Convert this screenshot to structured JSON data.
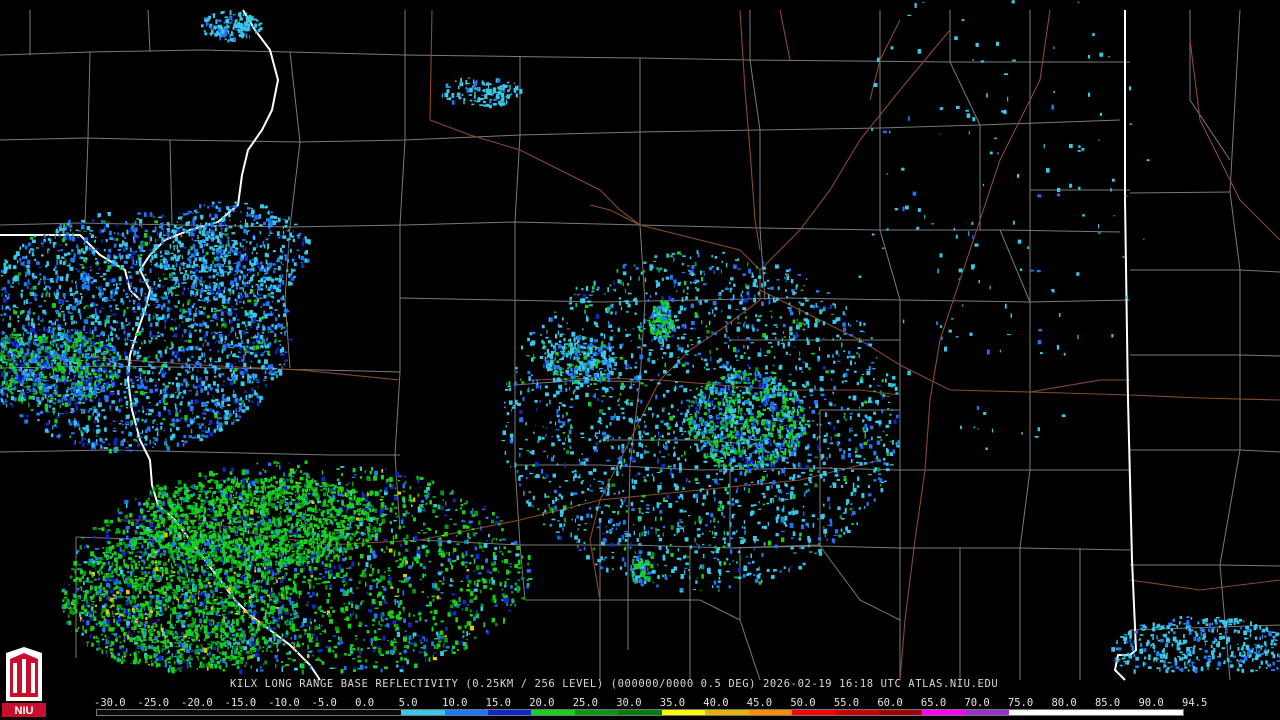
{
  "product": {
    "caption": "KILX LONG RANGE BASE REFLECTIVITY (0.25KM / 256 LEVEL) (000000/0000 0.5 DEG) 2026-02-19 16:18 UTC  ATLAS.NIU.EDU"
  },
  "colorbar": {
    "ticks": [
      "-30.0",
      "-25.0",
      "-20.0",
      "-15.0",
      "-10.0",
      "-5.0",
      "0.0",
      "5.0",
      "10.0",
      "15.0",
      "20.0",
      "25.0",
      "30.0",
      "35.0",
      "40.0",
      "45.0",
      "50.0",
      "55.0",
      "60.0",
      "65.0",
      "70.0",
      "75.0",
      "80.0",
      "85.0",
      "90.0",
      "94.5"
    ],
    "colors": [
      "#0a0a0a",
      "#0a0a0a",
      "#0a0a0a",
      "#0a0a0a",
      "#0a0a0a",
      "#0a0a0a",
      "#0a0a0a",
      "#39c8e8",
      "#1e78ff",
      "#1028c8",
      "#14d21e",
      "#0a9614",
      "#087a10",
      "#ffff00",
      "#e6b400",
      "#ff8c00",
      "#ff0000",
      "#c80000",
      "#a00000",
      "#ff00ff",
      "#9632c8",
      "#ffffff",
      "#ffffff",
      "#ffffff",
      "#ffffff"
    ]
  },
  "logo": {
    "text": "NIU",
    "colors": {
      "red": "#c8102e",
      "white": "#ffffff"
    }
  },
  "map_colors": {
    "county_lines": "#7a7a7a",
    "state_lines": "#ffffff",
    "highways": "#8b4a2a"
  },
  "radar": {
    "site": "KILX",
    "echo_colors": [
      "#39c8e8",
      "#1e78ff",
      "#1028c8",
      "#14d21e",
      "#0a9614",
      "#e6c800"
    ]
  }
}
